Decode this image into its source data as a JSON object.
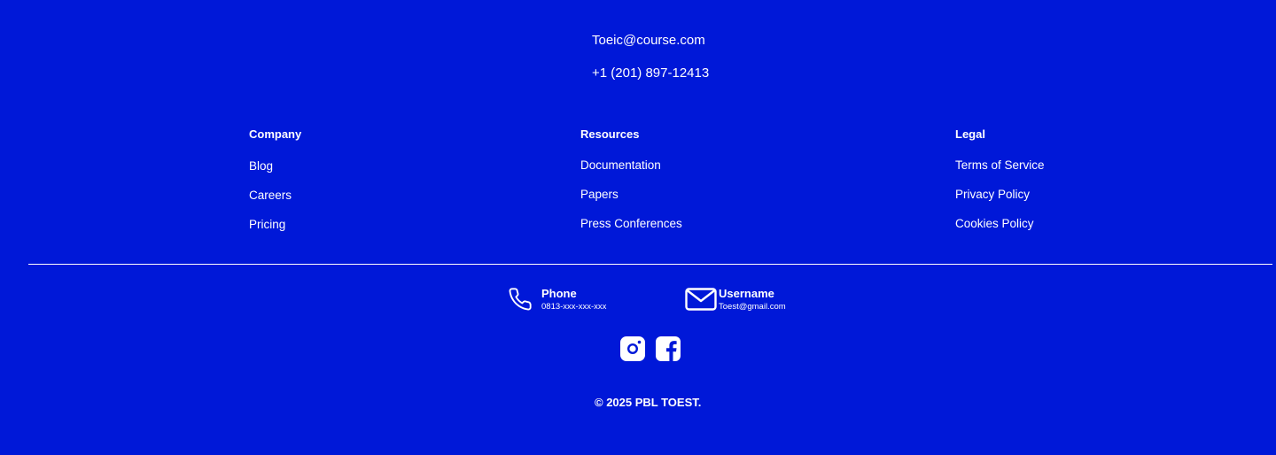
{
  "colors": {
    "background": "#0018D8",
    "text": "#ffffff"
  },
  "top_contact": {
    "email": "Toeic@course.com",
    "phone": "+1 (201) 897-12413"
  },
  "columns": [
    {
      "title": "Company",
      "links": [
        "Blog",
        "Careers",
        "Pricing"
      ]
    },
    {
      "title": "Resources",
      "links": [
        "Documentation",
        "Papers",
        "Press Conferences"
      ]
    },
    {
      "title": "Legal",
      "links": [
        "Terms of Service",
        "Privacy Policy",
        "Cookies Policy"
      ]
    }
  ],
  "contacts": {
    "phone": {
      "icon": "phone-icon",
      "title": "Phone",
      "value": "0813-xxx-xxx-xxx"
    },
    "mail": {
      "icon": "mail-icon",
      "title": "Username",
      "value": "Toest@gmail.com"
    }
  },
  "socials": [
    {
      "icon": "instagram-icon"
    },
    {
      "icon": "facebook-icon"
    }
  ],
  "copyright": "© 2025 PBL TOEST."
}
